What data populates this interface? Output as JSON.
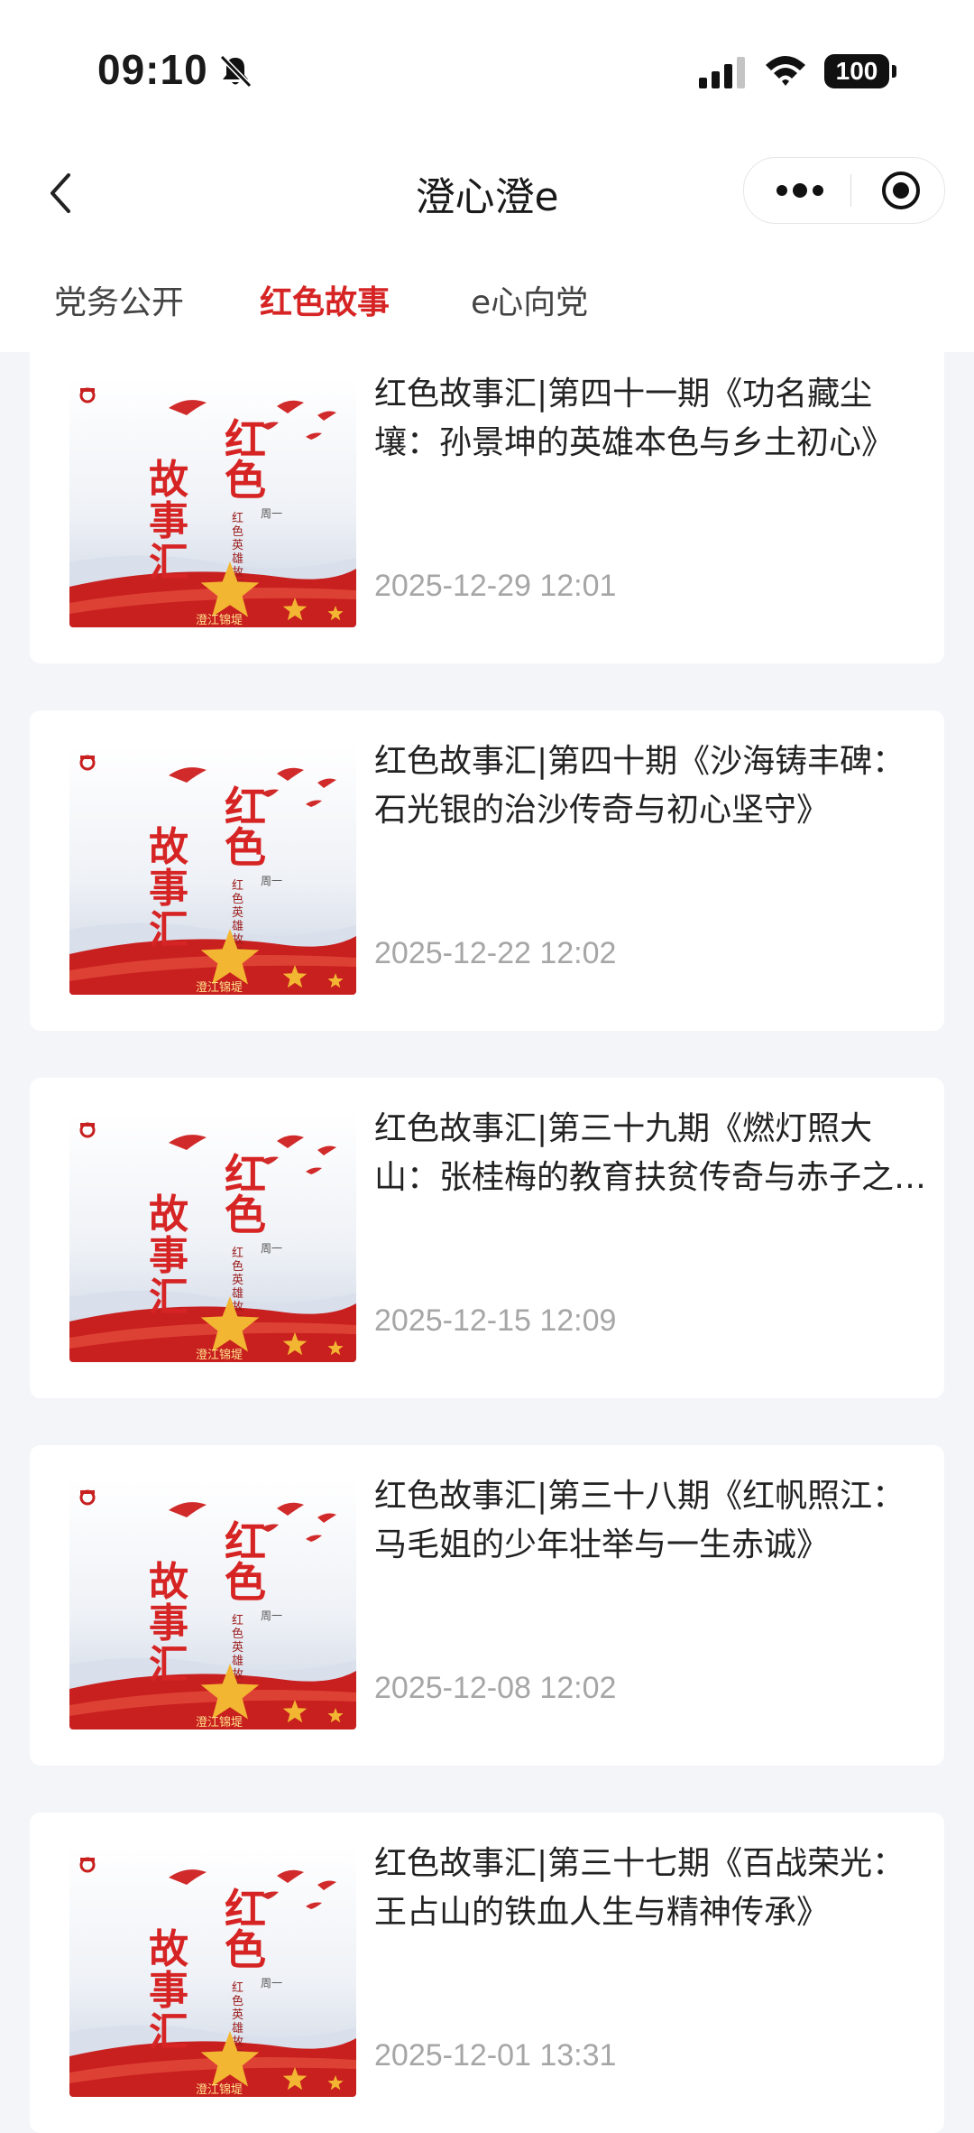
{
  "status_bar": {
    "time": "09:10",
    "battery": "100"
  },
  "nav": {
    "title": "澄心澄e"
  },
  "tabs": [
    {
      "label": "党务公开",
      "active": false
    },
    {
      "label": "红色故事",
      "active": true
    },
    {
      "label": "e心向党",
      "active": false
    }
  ],
  "thumbnail": {
    "main_text": "故事汇",
    "side_text": "红色",
    "sub_text": "红色英雄故事",
    "tag": "周一",
    "footer": "澄江锦堤"
  },
  "articles": [
    {
      "title": "红色故事汇|第四十一期《功名藏尘壤：孙景坤的英雄本色与乡土初心》",
      "date": "2025-12-29 12:01"
    },
    {
      "title": "红色故事汇|第四十期《沙海铸丰碑：石光银的治沙传奇与初心坚守》",
      "date": "2025-12-22 12:02"
    },
    {
      "title": "红色故事汇|第三十九期《燃灯照大山：张桂梅的教育扶贫传奇与赤子之心》",
      "date": "2025-12-15 12:09"
    },
    {
      "title": "红色故事汇|第三十八期《红帆照江：马毛姐的少年壮举与一生赤诚》",
      "date": "2025-12-08 12:02"
    },
    {
      "title": "红色故事汇|第三十七期《百战荣光：王占山的铁血人生与精神传承》",
      "date": "2025-12-01 13:31"
    }
  ],
  "colors": {
    "accent": "#d62424",
    "background": "#f4f5f9"
  }
}
